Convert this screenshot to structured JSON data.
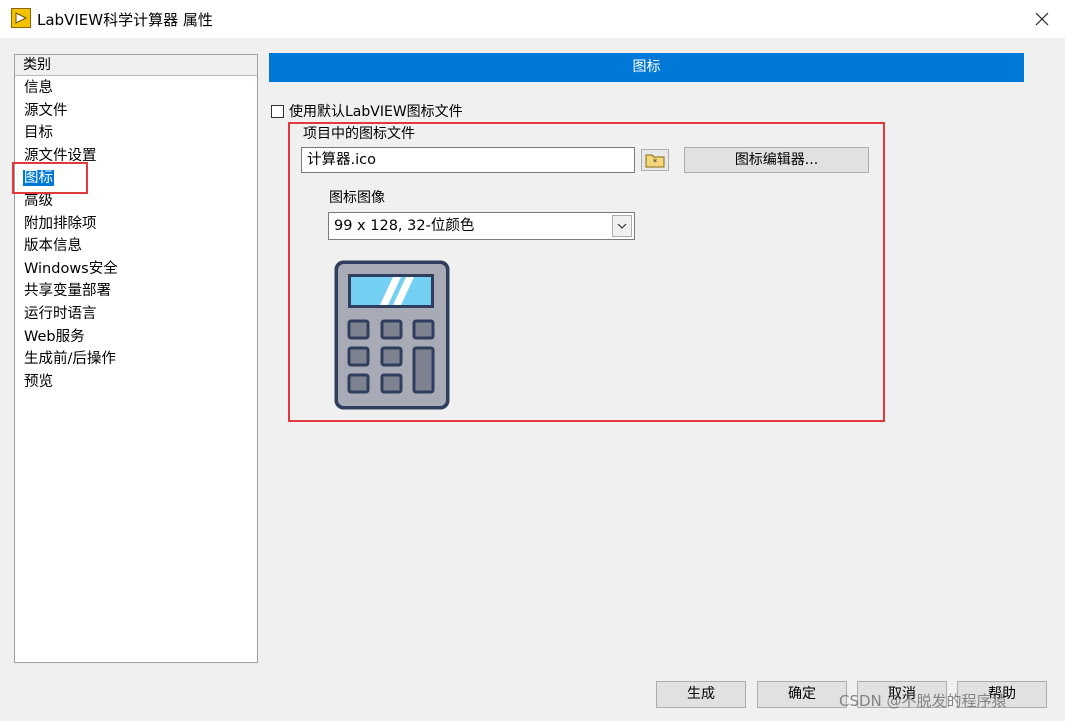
{
  "window": {
    "title": "LabVIEW科学计算器 属性",
    "close_icon": "close-icon"
  },
  "categories": {
    "header": "类别",
    "items": [
      "信息",
      "源文件",
      "目标",
      "源文件设置",
      "图标",
      "高级",
      "附加排除项",
      "版本信息",
      "Windows安全",
      "共享变量部署",
      "运行时语言",
      "Web服务",
      "生成前/后操作",
      "预览"
    ],
    "selected": "图标"
  },
  "section": {
    "title": "图标"
  },
  "use_default": {
    "label": "使用默认LabVIEW图标文件",
    "checked": false
  },
  "icon_file": {
    "label": "项目中的图标文件",
    "value": "计算器.ico",
    "browse_icon": "folder-browse-icon",
    "editor_button": "图标编辑器..."
  },
  "icon_image": {
    "label": "图标图像",
    "selected": "99 x 128, 32-位颜色",
    "preview_icon": "calculator-icon"
  },
  "buttons": {
    "build": "生成",
    "ok": "确定",
    "cancel": "取消",
    "help": "帮助"
  },
  "watermark": "CSDN @不脱发的程序猿",
  "colors": {
    "accent": "#0078d7",
    "highlight": "#e0393e"
  }
}
